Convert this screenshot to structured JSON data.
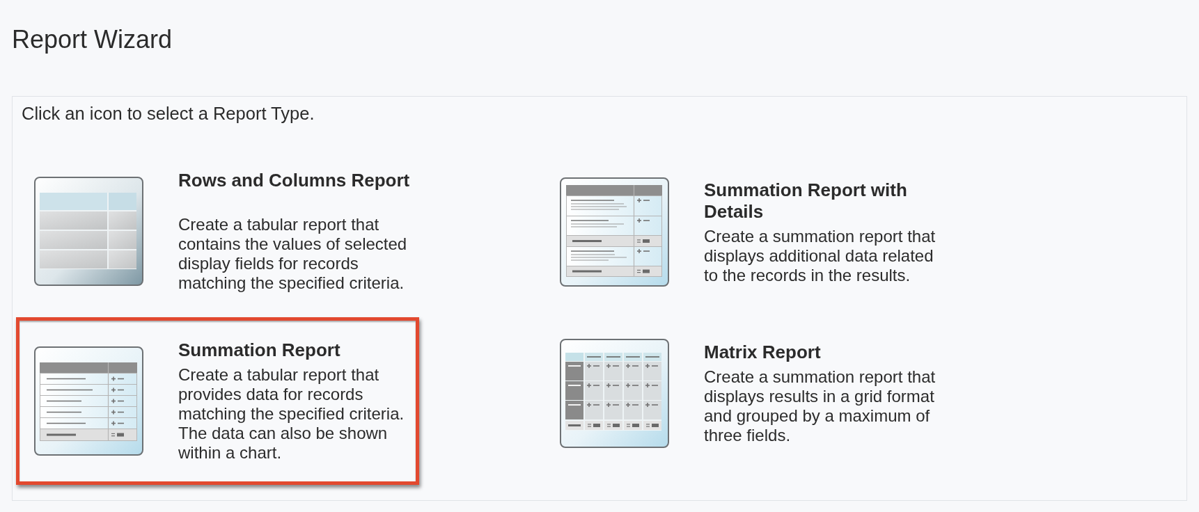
{
  "page": {
    "title": "Report Wizard"
  },
  "panel": {
    "instruction": "Click an icon to select a Report Type."
  },
  "report_types": [
    {
      "kind": "tabular",
      "title": "Rows and Columns Report",
      "description": "Create a tabular report that contains the values of selected display fields for records matching the specified criteria.",
      "selected": false
    },
    {
      "kind": "detailed",
      "title": "Summation Report with Details",
      "description": "Create a summation report that displays additional data related to the records in the results.",
      "selected": false
    },
    {
      "kind": "summary",
      "title": "Summation Report",
      "description": "Create a tabular report that provides data for records matching the specified criteria. The data can also be shown within a chart.",
      "selected": true
    },
    {
      "kind": "matrix",
      "title": "Matrix Report",
      "description": "Create a summation report that displays results in a grid format and grouped by a maximum of three fields.",
      "selected": false
    }
  ]
}
